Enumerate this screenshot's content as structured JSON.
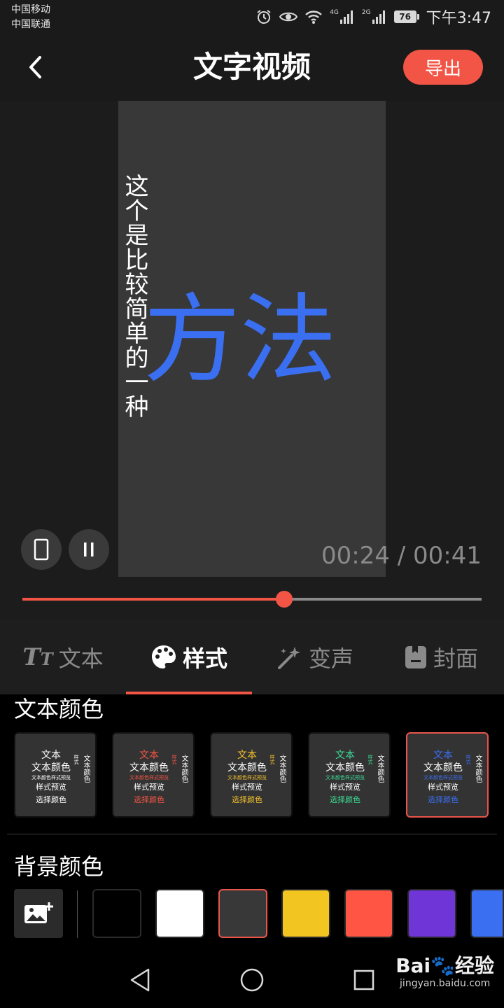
{
  "status_bar": {
    "carrier_1": "中国移动",
    "carrier_2": "中国联通",
    "net_1": "4G",
    "net_2": "2G",
    "battery": "76",
    "time": "下午3:47"
  },
  "header": {
    "title": "文字视频",
    "export_label": "导出"
  },
  "video": {
    "vertical_text": "这个是比较简单的一种",
    "big_text": "方法",
    "big_text_color": "#3b6ff2",
    "current_time": "00:24",
    "separator": " / ",
    "total_time": "00:41",
    "progress_fraction": 0.57
  },
  "tabs": [
    {
      "label": "文本",
      "icon": "text-icon",
      "active": false
    },
    {
      "label": "样式",
      "icon": "palette-icon",
      "active": true
    },
    {
      "label": "变声",
      "icon": "magic-wand-icon",
      "active": false
    },
    {
      "label": "封面",
      "icon": "cover-icon",
      "active": false
    }
  ],
  "text_color": {
    "title": "文本颜色",
    "card_lines": [
      "文本",
      "文本颜色",
      "文本颜色样式预览",
      "样式预览",
      "选择颜色"
    ],
    "card_vertical": [
      "样式",
      "文本颜色"
    ],
    "cards": [
      {
        "accent": "#ffffff",
        "selected": false
      },
      {
        "accent": "#f25545",
        "selected": false
      },
      {
        "accent": "#f2c12e",
        "selected": false
      },
      {
        "accent": "#3ddc97",
        "selected": false
      },
      {
        "accent": "#3b6ff2",
        "selected": true
      }
    ]
  },
  "background_color": {
    "title": "背景颜色",
    "swatches": [
      {
        "color": "#000000",
        "selected": false
      },
      {
        "color": "#ffffff",
        "selected": false
      },
      {
        "color": "#383838",
        "selected": true
      },
      {
        "color": "#f2c520",
        "selected": false
      },
      {
        "color": "#ff5545",
        "selected": false
      },
      {
        "color": "#6f35d6",
        "selected": false
      },
      {
        "color": "#3b6ff2",
        "selected": false
      }
    ]
  },
  "watermark": {
    "main": "Bai🐾经验",
    "sub": "jingyan.baidu.com"
  }
}
